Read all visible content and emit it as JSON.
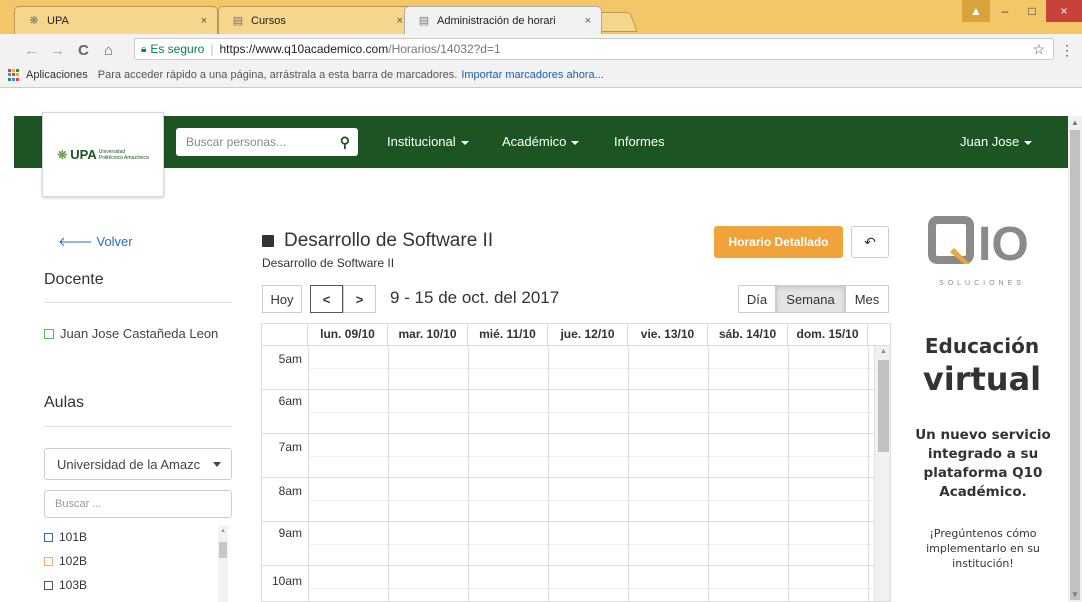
{
  "browser": {
    "tabs": [
      {
        "label": "UPA",
        "close": "×"
      },
      {
        "label": "Cursos",
        "close": "×"
      },
      {
        "label": "Administración de horari",
        "close": "×"
      }
    ],
    "window_controls": {
      "user": "▲",
      "minimize": "–",
      "maximize": "□",
      "close": "×"
    },
    "nav": {
      "back": "←",
      "forward": "→",
      "reload": "C",
      "home": "⌂"
    },
    "omnibox": {
      "secure_label": "Es seguro",
      "url_host": "https://www.q10academico.com",
      "url_path": "/Horarios/14032?d=1"
    },
    "bookmarks": {
      "apps_label": "Aplicaciones",
      "hint": "Para acceder rápido a una página, arrástrala a esta barra de marcadores.",
      "import_link": "Importar marcadores ahora..."
    }
  },
  "app": {
    "logo": {
      "mark": "UPA",
      "sub_line1": "Universidad",
      "sub_line2": "Politécnico Amazónica"
    },
    "search": {
      "placeholder": "Buscar personas..."
    },
    "menu": [
      {
        "label": "Institucional"
      },
      {
        "label": "Académico"
      },
      {
        "label": "Informes"
      }
    ],
    "user_menu": "Juan Jose"
  },
  "sidebar": {
    "back": "Volver",
    "teacher_heading": "Docente",
    "teacher_name": "Juan Jose Castañeda Leon",
    "rooms_heading": "Aulas",
    "campus_select": "Universidad de la Amazc",
    "room_search_placeholder": "Buscar ...",
    "rooms": [
      {
        "label": "101B",
        "color": "#2a6db5"
      },
      {
        "label": "102B",
        "color": "#f0ad4e"
      },
      {
        "label": "103B",
        "color": "#555555"
      }
    ]
  },
  "schedule": {
    "title": "Desarrollo de Software II",
    "subtitle": "Desarrollo de Software II",
    "detailed_button": "Horario Detallado",
    "undo_icon": "↶",
    "today": "Hoy",
    "prev": "<",
    "next": ">",
    "date_range": "9 - 15 de oct. del 2017",
    "views": [
      {
        "label": "Día",
        "active": false
      },
      {
        "label": "Semana",
        "active": true
      },
      {
        "label": "Mes",
        "active": false
      }
    ],
    "days": [
      "lun. 09/10",
      "mar. 10/10",
      "mié. 11/10",
      "jue. 12/10",
      "vie. 13/10",
      "sáb. 14/10",
      "dom. 15/10"
    ],
    "hours": [
      "5am",
      "6am",
      "7am",
      "8am",
      "9am",
      "10am"
    ]
  },
  "ad": {
    "brand_suffix": "IO",
    "tagline": "SOLUCIONES",
    "heading1": "Educación",
    "heading2": "virtual",
    "pitch": "Un nuevo servicio integrado a su plataforma Q10 Académico.",
    "question": "¡Pregúntenos cómo implementarlo en su institución!"
  }
}
